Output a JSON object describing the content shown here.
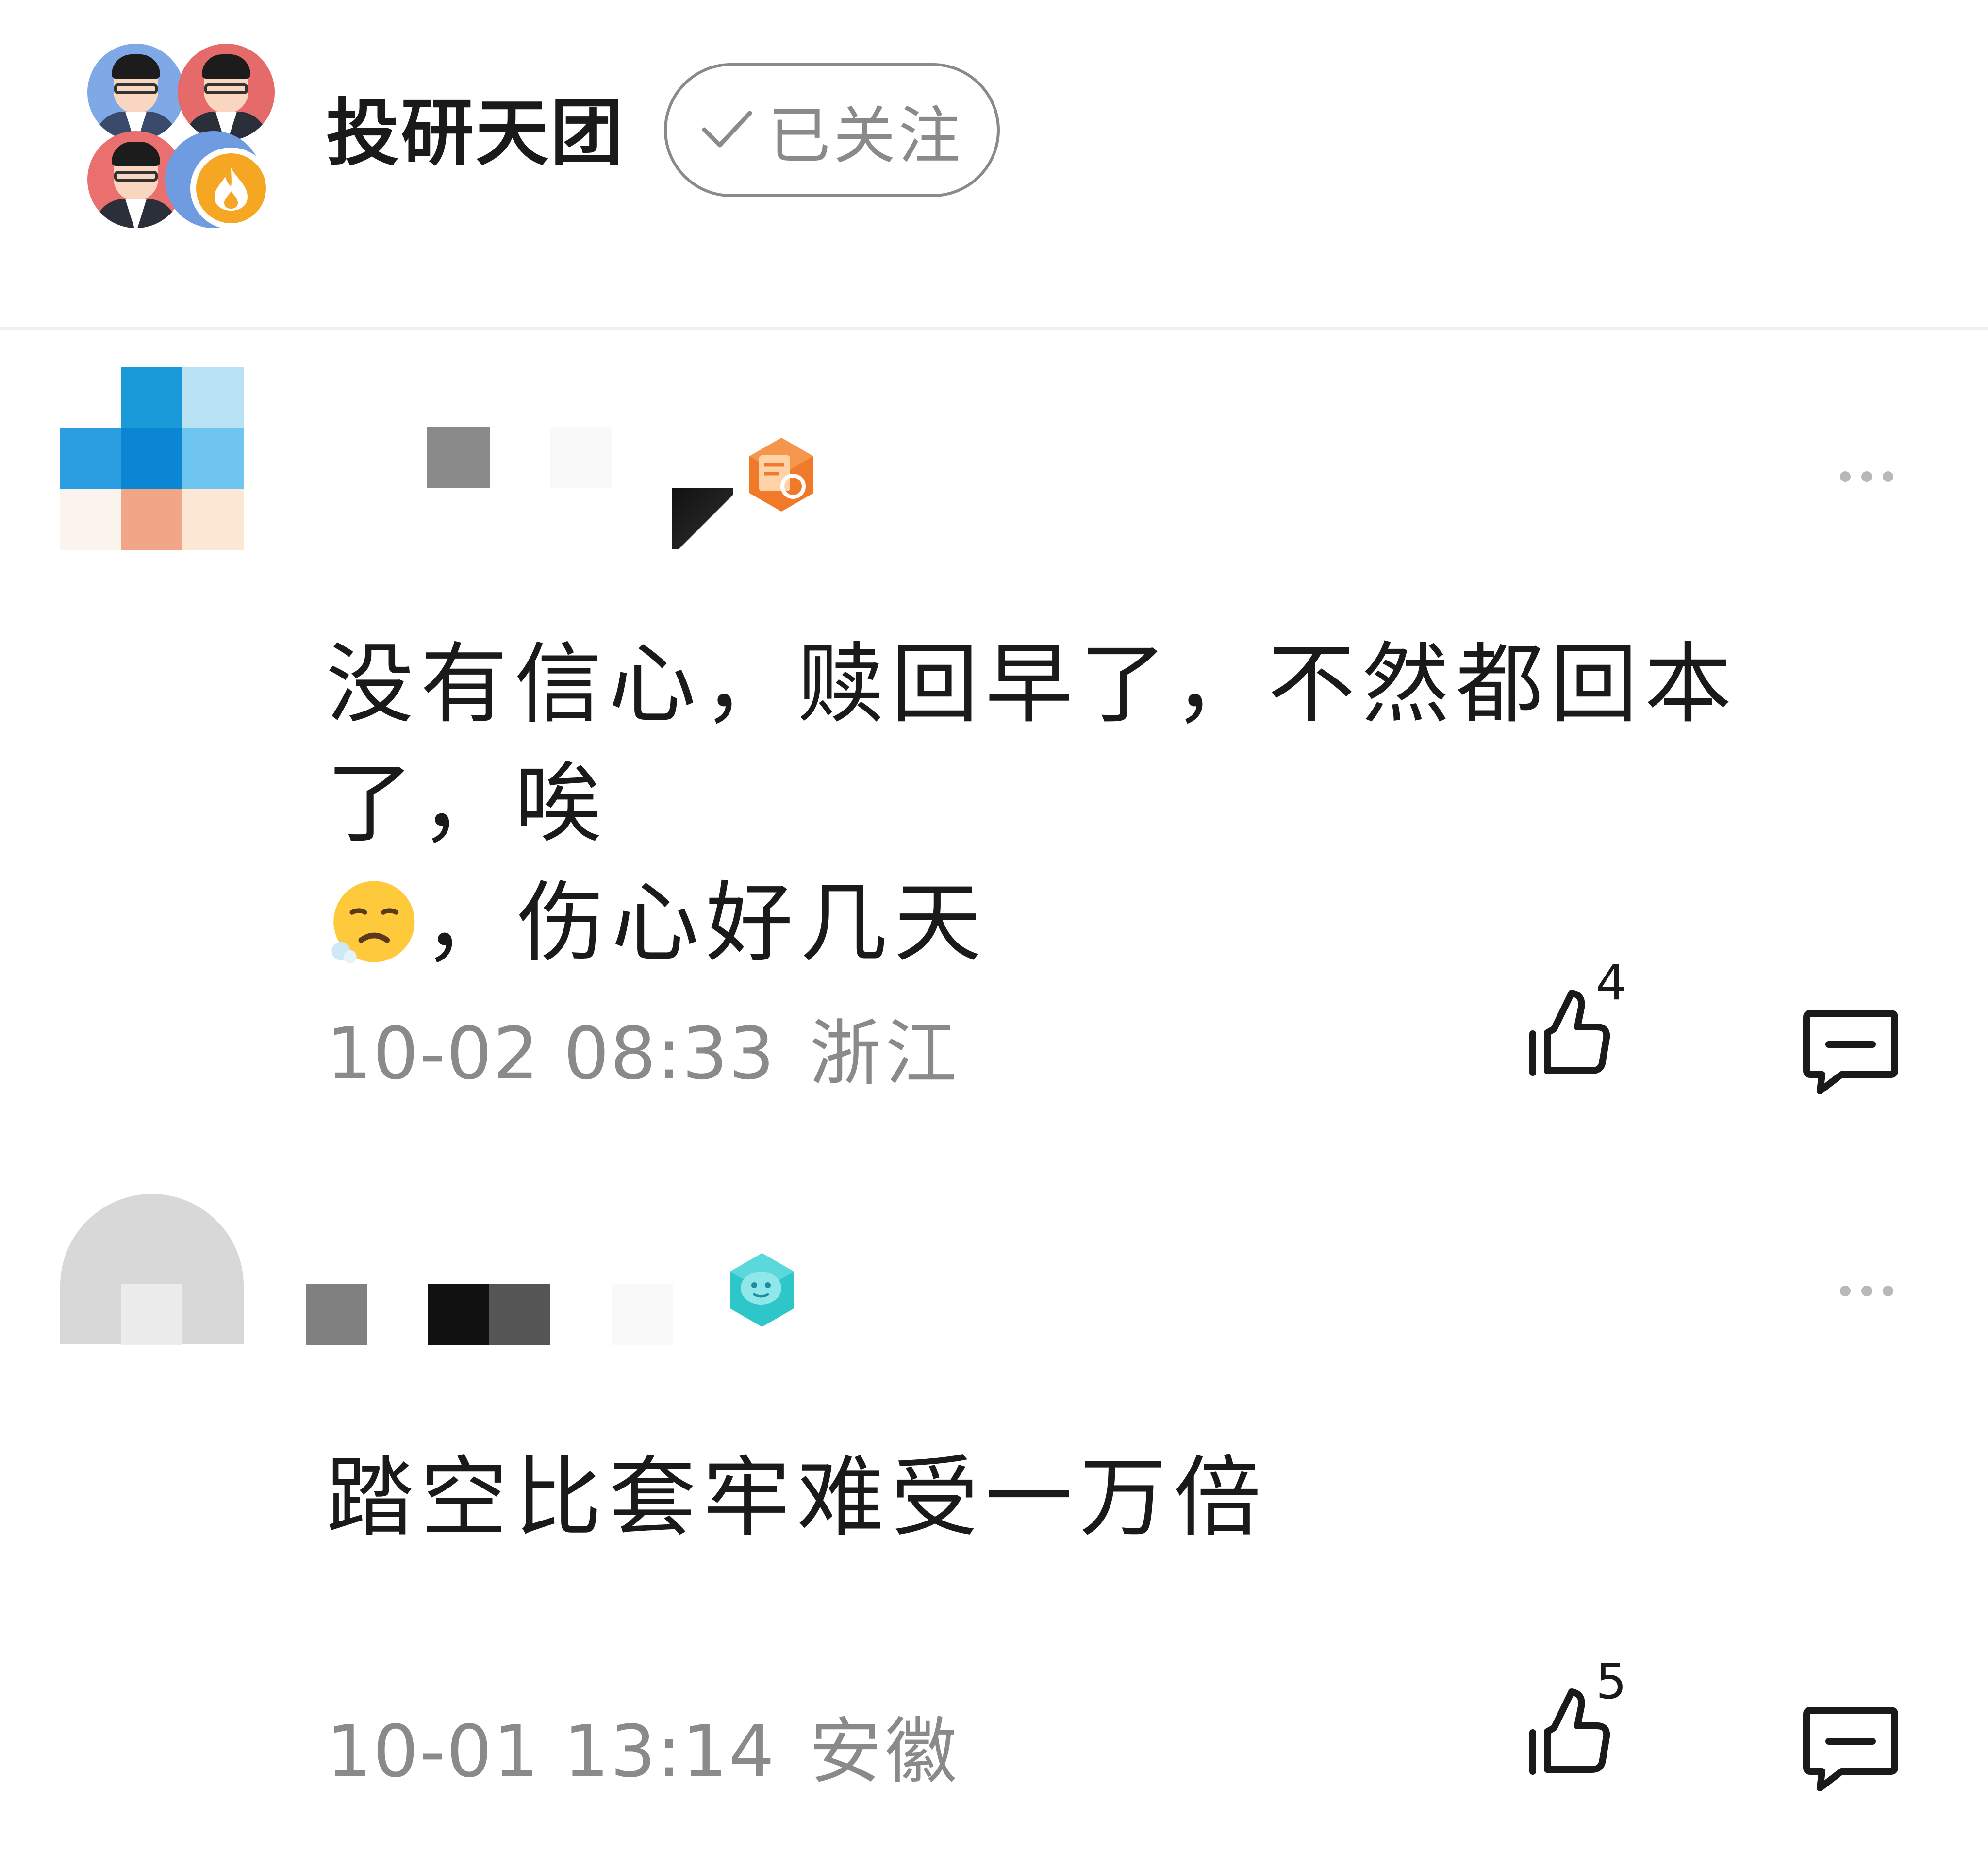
{
  "header": {
    "group_name": "投研天团",
    "follow_label": "已关注"
  },
  "comments": [
    {
      "text_line1": "没有信心，赎回早了，不然都回本了，唉",
      "text_line2": "，伤心好几天",
      "date": "10-02 08:33",
      "location": "浙江",
      "likes": "4",
      "badge_icon": "document-badge-icon",
      "avatar_colors": [
        "#1a9ad9",
        "#b9e2f5",
        "#2a9ee0",
        "#0a86d4",
        "#6ec5ef",
        "#fbf4ee",
        "#f1a688",
        "#fde8d6"
      ]
    },
    {
      "text_line1": "踏空比套牢难受一万倍",
      "date": "10-01 13:14",
      "location": "安徽",
      "likes": "5",
      "badge_icon": "chat-badge-icon"
    }
  ],
  "colors": {
    "text_primary": "#1a1a1a",
    "text_secondary": "#8a8a8a",
    "divider": "#f0f0f0",
    "badge_orange": "#f07a2a",
    "badge_teal": "#2ec6c8",
    "fire_badge": "#f5a623"
  }
}
